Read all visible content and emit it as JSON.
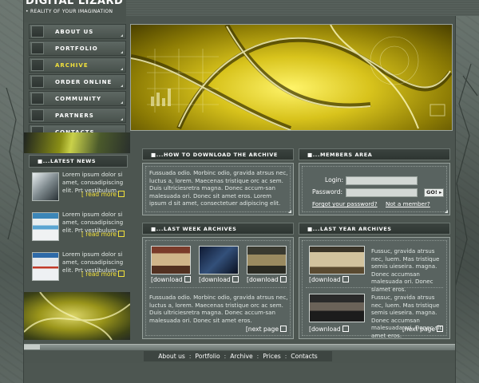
{
  "header": {
    "logo_title": "DIGITAL LIZARD",
    "logo_subtitle": "• REALITY OF YOUR IMAGINATION"
  },
  "nav": {
    "items": [
      {
        "label": "ABOUT US",
        "active": false
      },
      {
        "label": "PORTFOLIO",
        "active": false
      },
      {
        "label": "ARCHIVE",
        "active": true
      },
      {
        "label": "ORDER ONLINE",
        "active": false
      },
      {
        "label": "COMMUNITY",
        "active": false
      },
      {
        "label": "PARTNERS",
        "active": false
      },
      {
        "label": "CONTACTS",
        "active": false
      }
    ]
  },
  "latest_news": {
    "title": "■...LATEST NEWS",
    "items": [
      {
        "text": "Lorem ipsum dolor si amet, consadipiscing elit. Prt vestibulum.",
        "link": "[ read more"
      },
      {
        "text": "Lorem ipsum dolor si amet, consadipiscing elit. Prt vestibulum.",
        "link": "[ read more"
      },
      {
        "text": "Lorem ipsum dolor si amet, consadipiscing elit. Prt vestibulum.",
        "link": "[ read more"
      }
    ]
  },
  "how_to": {
    "title": "■...HOW TO DOWNLOAD THE ARCHIVE",
    "text": "Fussuada odio. Morbinc odio, gravida atrsus nec, luctus a, lorem. Maecenas tristique orc ac sem. Duis ultriciesretra magna. Donec accum-san malesuada ori. Donec sit amet eros. Lorem ipsum d sit amet, consectetuer adipiscing elit."
  },
  "members": {
    "title": "■...MEMBERS AREA",
    "login_label": "Login:",
    "password_label": "Password:",
    "go_label": "GO!",
    "forgot_link": "Forgot your password?",
    "notmember_link": "Not a member?"
  },
  "last_week": {
    "title": "■...LAST WEEK ARCHIVES",
    "downloads": [
      "[download",
      "[download",
      "[download"
    ],
    "text": "Fussuada odio. Morbinc odio, gravida atrsus nec, luctus a, lorem. Maecenas tristique orc ac sem. Duis ultriciesretra magna. Donec accum-san malesuada ori. Donec sit amet eros.",
    "next": "[next page"
  },
  "last_year": {
    "title": "■...LAST YEAR ARCHIVES",
    "text1": "Fussuc, gravida atrsus nec, luem. Mas tristique semis uieseira. magna. Donec accumsan malesuada ori. Donec siamet eros.",
    "text2": "Fussuc, gravida atrsus nec, luem. Mas tristique semis uieseira. magna. Donec accumsan malesuada ori. Donec sit amet eros.",
    "downloads": [
      "[download",
      "[download"
    ],
    "next": "[next page"
  },
  "footer": {
    "links": [
      "About us",
      "Portfolio",
      "Archive",
      "Prices",
      "Contacts"
    ]
  },
  "colors": {
    "accent_yellow": "#f1e03b",
    "panel": "#596360",
    "dark": "#2e3531"
  }
}
